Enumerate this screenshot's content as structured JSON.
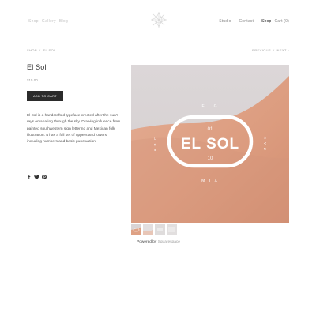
{
  "header": {
    "nav_left": [
      "Shop",
      "Gallery",
      "Blog"
    ],
    "logo_icon": "sun-star-icon",
    "nav_right": {
      "studio": "Studio",
      "separator": "·",
      "contact": "Contact",
      "shop": "Shop",
      "cart": "Cart (0)"
    }
  },
  "breadcrumb": {
    "shop": "SHOP",
    "separator": "/",
    "current": "EL SOL"
  },
  "pager": {
    "previous": "‹ PREVIOUS",
    "separator": "/",
    "next": "NEXT ›"
  },
  "product": {
    "title": "El Sol",
    "price": "$15.00",
    "add_to_cart": "ADD TO CART",
    "description": "El Sol is a handcrafted typeface created after the sun's rays emanating through the sky. Drawing influence from painted southwestern sign lettering and Mexican folk illustration. It has a full set of uppers and lowers, including numbers and basic punctuation.",
    "share_icons": [
      "facebook-icon",
      "twitter-icon",
      "pinterest-icon"
    ]
  },
  "image": {
    "logo_text": "EL SOL",
    "top_letters": "F I G",
    "bottom_letters": "M I X",
    "left_letters": "A B C",
    "right_letters": "X Y Z",
    "left_num": "01",
    "right_num": "10",
    "colors": {
      "sky": "#d8d3d4",
      "dune": "#e1a58a",
      "dune_shadow": "#cf8c70"
    }
  },
  "thumbnails": {
    "count": 4,
    "active_index": 0
  },
  "footer": {
    "powered_by": "Powered by",
    "brand": "Squarespace"
  }
}
